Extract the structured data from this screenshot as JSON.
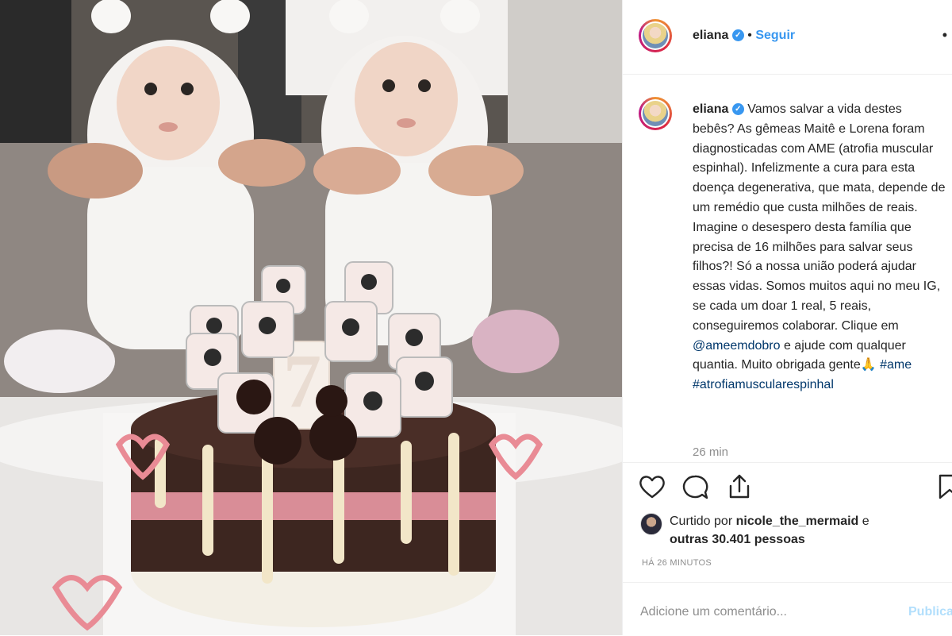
{
  "post": {
    "username": "eliana",
    "verified_badge": "✓",
    "dot": "•",
    "follow_label": "Seguir",
    "more_label": "•",
    "caption_username": "eliana",
    "caption_text_1": "Vamos salvar a vida destes bebês? As gêmeas Maitê e Lorena foram diagnosticadas com AME (atrofia muscular espinhal). Infelizmente a cura para esta doença degenerativa, que mata, depende de um remédio que custa milhões de reais. Imagine o desespero desta família que precisa de 16 milhões para salvar seus filhos?! Só a nossa união poderá ajudar essas vidas. Somos muitos aqui no meu IG, se cada um doar 1 real, 5 reais, conseguiremos colaborar. Clique em ",
    "mention": "@ameemdobro",
    "caption_text_2": " e ajude com qualquer quantia. Muito obrigada gente🙏 ",
    "hashtag_1": "#ame",
    "hashtag_2": "#atrofiamuscularespinhal",
    "comment_time": "26 min",
    "liked_prefix": "Curtido por ",
    "liked_user": "nicole_the_mermaid",
    "liked_mid": " e ",
    "liked_others": "outras 30.401 pessoas",
    "posted_ago": "HÁ 26 MINUTOS",
    "comment_placeholder": "Adicione um comentário...",
    "publish_label": "Publicar"
  },
  "photo": {
    "cake_number": "7"
  },
  "icons": [
    "heart-icon",
    "comment-icon",
    "share-icon",
    "bookmark-icon",
    "more-options-icon"
  ],
  "colors": {
    "accent": "#3897f0",
    "link": "#00376b",
    "muted": "#8e8e8e",
    "publish_disabled": "#b2dffc"
  }
}
